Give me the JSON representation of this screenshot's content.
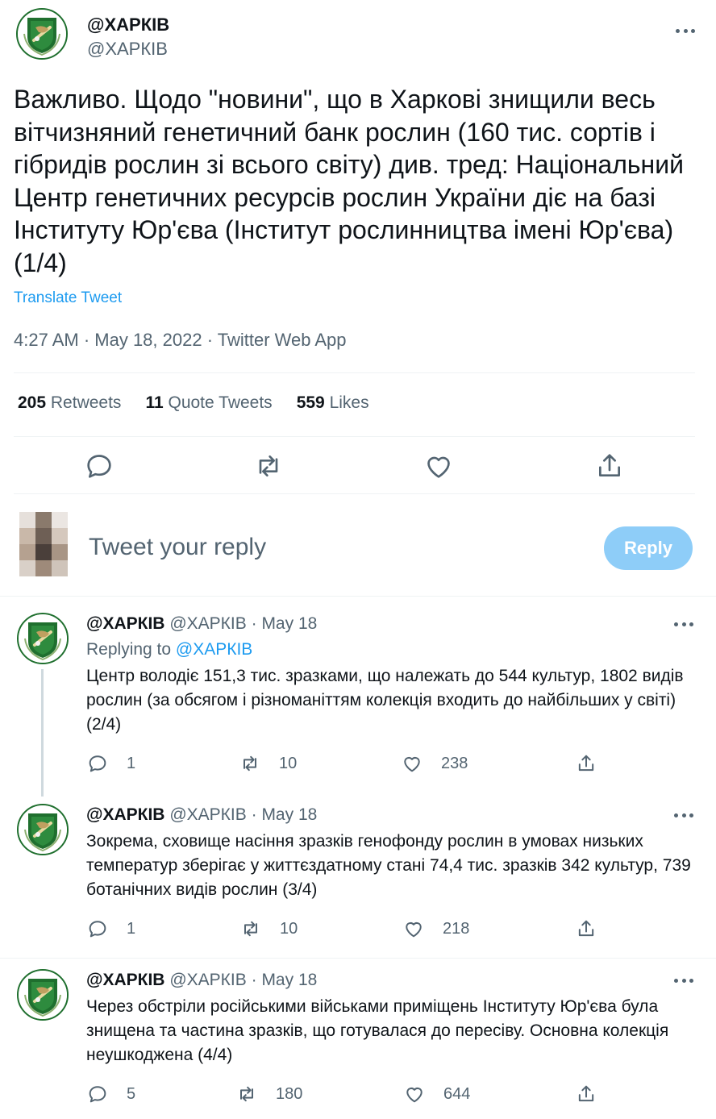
{
  "main_tweet": {
    "display_name": "@ХАРКІВ",
    "handle": "@ХАРКІВ",
    "text": "Важливо. Щодо \"новини\", що в Харкові знищили весь вітчизняний генетичний банк рослин (160 тис. сортів і гібридів рослин зі всього світу) див. тред: Національний Центр генетичних ресурсів рослин України діє на базі Інституту Юр'єва (Інститут рослинництва імені Юр'єва) (1/4)",
    "translate_label": "Translate Tweet",
    "meta": "4:27 AM · May 18, 2022 · Twitter Web App",
    "stats": {
      "retweets_count": "205",
      "retweets_label": "Retweets",
      "quotes_count": "11",
      "quotes_label": "Quote Tweets",
      "likes_count": "559",
      "likes_label": "Likes"
    }
  },
  "reply_box": {
    "placeholder": "Tweet your reply",
    "button_label": "Reply"
  },
  "thread": [
    {
      "display_name": "@ХАРКІВ",
      "handle": "@ХАРКІВ",
      "separator": "·",
      "date": "May 18",
      "replying_label": "Replying to",
      "replying_to": "@ХАРКІВ",
      "text": "Центр володіє 151,3 тис. зразками, що належать до 544 культур, 1802 видів рослин (за обсягом і різноманіттям колекція входить до найбільших у світі) (2/4)",
      "replies": "1",
      "retweets": "10",
      "likes": "238"
    },
    {
      "display_name": "@ХАРКІВ",
      "handle": "@ХАРКІВ",
      "separator": "·",
      "date": "May 18",
      "text": "Зокрема, сховище насіння зразків генофонду рослин в умовах низьких температур зберігає у життєздатному стані 74,4 тис. зразків 342 культур, 739 ботанічних видів рослин (3/4)",
      "replies": "1",
      "retweets": "10",
      "likes": "218"
    },
    {
      "display_name": "@ХАРКІВ",
      "handle": "@ХАРКІВ",
      "separator": "·",
      "date": "May 18",
      "text": "Через обстріли російськими військами приміщень Інституту Юр'єва була знищена та частина зразків, що готувалася до пересіву. Основна колекція неушкоджена (4/4)",
      "replies": "5",
      "retweets": "180",
      "likes": "644"
    }
  ],
  "colors": {
    "accent": "#1d9bf0",
    "reply_button_disabled": "#8ecdf8",
    "secondary_text": "#536471",
    "divider": "#eff3f4",
    "emblem_green": "#1f6f2e"
  }
}
